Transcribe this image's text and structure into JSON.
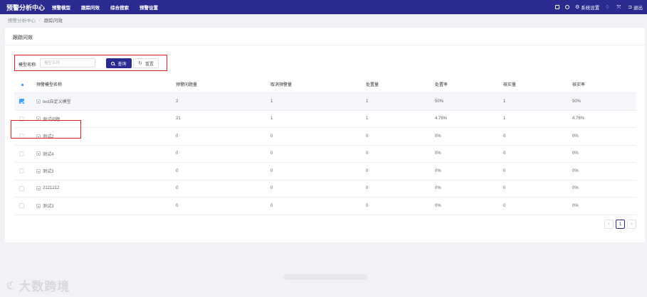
{
  "topbar": {
    "brand": "预警分析中心",
    "nav": [
      "预警模型",
      "跟踪问效",
      "综合搜索",
      "预警设置"
    ],
    "right": {
      "system_settings": "系统设置",
      "logout": "退出"
    }
  },
  "breadcrumb": {
    "root": "预警分析中心",
    "sep": "/",
    "current": "跟踪问效"
  },
  "card": {
    "title": "跟踪问效"
  },
  "search": {
    "label": "模型名称:",
    "placeholder": "模型名称",
    "query_label": "查询",
    "reset_label": "重置"
  },
  "table": {
    "headers": [
      "预警模型名称",
      "预警问题量",
      "取消预警量",
      "处置量",
      "处置率",
      "核实量",
      "核实率"
    ],
    "rows": [
      {
        "name": "test自定义模型",
        "c1": "2",
        "c2": "1",
        "c3": "1",
        "c4": "50%",
        "c5": "1",
        "c6": "50%",
        "checked": true
      },
      {
        "name": "测试问题",
        "c1": "21",
        "c2": "1",
        "c3": "1",
        "c4": "4.76%",
        "c5": "1",
        "c6": "4.76%",
        "checked": false
      },
      {
        "name": "测试2",
        "c1": "0",
        "c2": "0",
        "c3": "0",
        "c4": "0%",
        "c5": "0",
        "c6": "0%",
        "checked": false
      },
      {
        "name": "测试4",
        "c1": "0",
        "c2": "0",
        "c3": "0",
        "c4": "0%",
        "c5": "0",
        "c6": "0%",
        "checked": false
      },
      {
        "name": "测试3",
        "c1": "0",
        "c2": "0",
        "c3": "0",
        "c4": "0%",
        "c5": "0",
        "c6": "0%",
        "checked": false
      },
      {
        "name": "2121212",
        "c1": "0",
        "c2": "0",
        "c3": "0",
        "c4": "0%",
        "c5": "0",
        "c6": "0%",
        "checked": false
      },
      {
        "name": "测试3",
        "c1": "0",
        "c2": "0",
        "c3": "0",
        "c4": "0%",
        "c5": "0",
        "c6": "0%",
        "checked": false
      }
    ]
  },
  "pagination": {
    "prev": "<",
    "page": "1",
    "next": ">"
  },
  "watermark": {
    "text": "大数跨境"
  },
  "colors": {
    "primary": "#2b2b8f",
    "highlight": "#e0201c",
    "checkbox": "#409eff"
  }
}
